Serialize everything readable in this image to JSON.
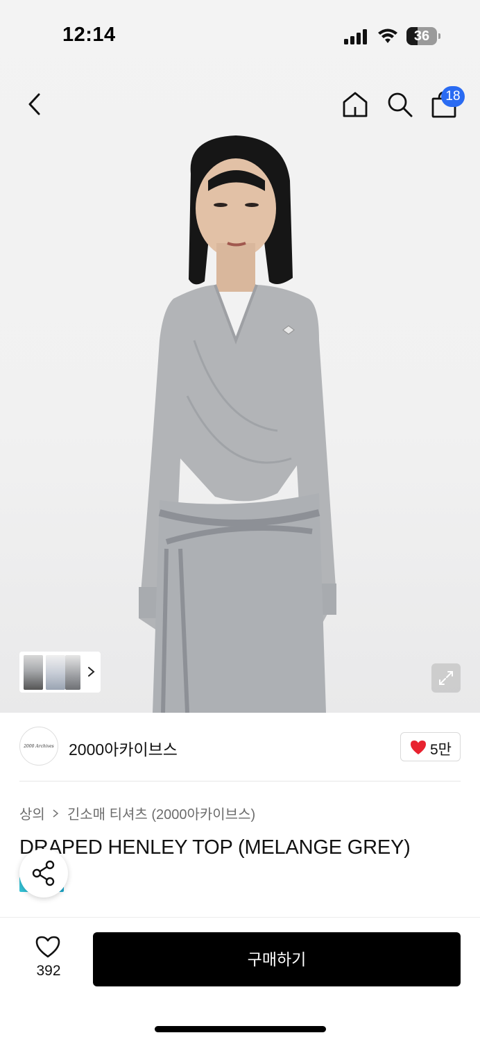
{
  "status_bar": {
    "time": "12:14",
    "battery_level": "36",
    "battery_fraction": 0.36
  },
  "nav": {
    "back_icon": "chevron-left-icon",
    "home_icon": "home-icon",
    "search_icon": "search-icon",
    "bag_icon": "shopping-bag-icon",
    "cart_count": "18"
  },
  "gallery": {
    "thumbnail_count": 3,
    "expand_icon": "expand-icon"
  },
  "brand": {
    "logo_text": "2000 Archives",
    "name": "2000아카이브스",
    "like_count": "5만"
  },
  "product": {
    "breadcrumb": [
      "상의",
      "긴소매 티셔츠 (2000아카이브스)"
    ],
    "title": "DRAPED HENLEY TOP (MELANGE GREY)"
  },
  "bottom_bar": {
    "wish_count": "392",
    "buy_label": "구매하기"
  },
  "colors": {
    "accent_badge": "#2a6bf2",
    "heart": "#e8222f",
    "buy_button": "#000000"
  }
}
